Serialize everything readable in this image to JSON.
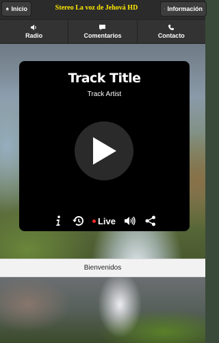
{
  "header": {
    "home_label": "Inicio",
    "station_title": "Stereo La voz de Jehová HD",
    "info_label": "Información"
  },
  "nav": {
    "items": [
      {
        "label": "Radio",
        "icon": "speaker-icon"
      },
      {
        "label": "Comentarios",
        "icon": "comment-icon"
      },
      {
        "label": "Contacto",
        "icon": "phone-icon"
      }
    ]
  },
  "player": {
    "track_title": "Track Title",
    "track_artist": "Track Artist",
    "live_label": "Live",
    "controls": [
      "info-icon",
      "history-icon",
      "live-indicator",
      "volume-icon",
      "share-icon"
    ]
  },
  "welcome": {
    "text": "Bienvenidos"
  },
  "colors": {
    "title_yellow": "#ffe800",
    "live_red": "#ff2a2a",
    "bar_dark": "#2b2b2b"
  }
}
